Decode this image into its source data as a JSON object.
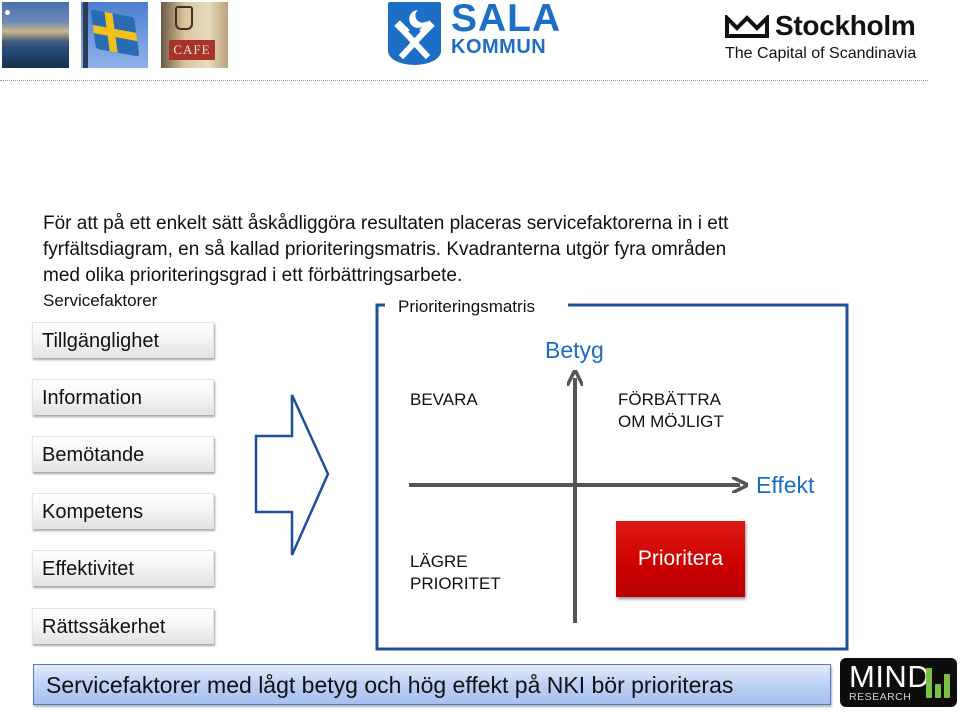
{
  "header": {
    "photos": [
      {
        "name": "stockholm-cityscape-photo"
      },
      {
        "name": "swedish-flag-photo"
      },
      {
        "name": "cafe-sign-photo",
        "sign_text": "CAFE"
      }
    ],
    "sala_logo": {
      "name": "SALA",
      "sub": "KOMMUN",
      "color": "#1d6ec6"
    },
    "stockholm_logo": {
      "name": "Stockholm",
      "tagline": "The Capital of Scandinavia"
    }
  },
  "intro": {
    "lines": [
      "För att på ett enkelt sätt åskådliggöra resultaten placeras servicefaktorerna in i ett",
      "fyrfältsdiagram, en så kallad prioriteringsmatris. Kvadranterna utgör fyra områden",
      "med olika prioriteringsgrad i ett förbättringsarbete."
    ]
  },
  "service_factors": {
    "title": "Servicefaktorer",
    "items": [
      {
        "label": "Tillgänglighet"
      },
      {
        "label": "Information"
      },
      {
        "label": "Bemötande"
      },
      {
        "label": "Kompetens"
      },
      {
        "label": "Effektivitet"
      },
      {
        "label": "Rättssäkerhet"
      }
    ]
  },
  "arrow": {
    "icon": "block-arrow-right-icon",
    "color": "#1f4e9a"
  },
  "matrix": {
    "title": "Prioriteringsmatris",
    "frame_color": "#1f4e9a",
    "y_axis_label": "Betyg",
    "x_axis_label": "Effekt",
    "axis_color": "#555555",
    "label_color": "#1c6cc4",
    "quadrants": {
      "top_left": [
        "BEVARA"
      ],
      "top_right": [
        "FÖRBÄTTRA",
        "OM MÖJLIGT"
      ],
      "bottom_left": [
        "LÄGRE",
        "PRIORITET"
      ],
      "bottom_right": "Prioritera"
    },
    "highlight_color": "#cc0000"
  },
  "banner": {
    "text": "Servicefaktorer med lågt betyg och hög effekt på NKI bör prioriteras"
  },
  "mind_logo": {
    "name": "MIND",
    "sub": "RESEARCH",
    "accent": "#7cc242"
  }
}
